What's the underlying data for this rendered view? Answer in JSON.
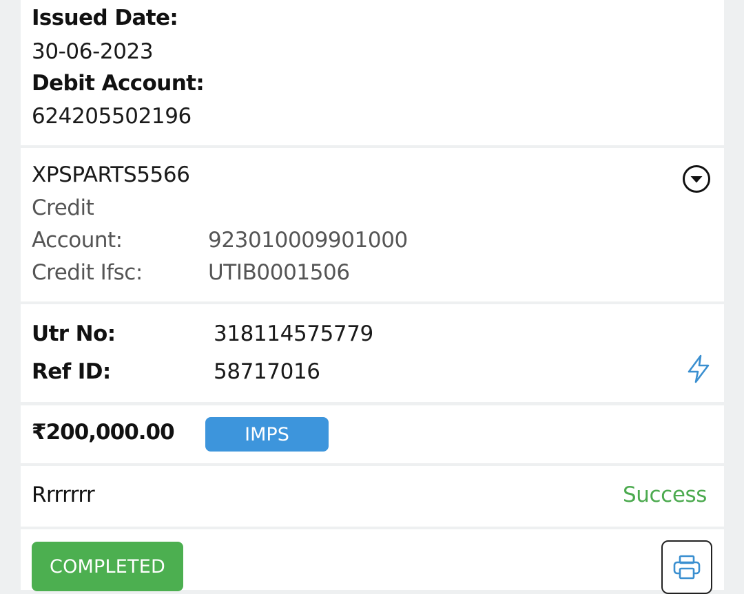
{
  "transaction": {
    "issued_date_label": "Issued Date:",
    "issued_date": "30-06-2023",
    "debit_account_label": "Debit Account:",
    "debit_account": "624205502196"
  },
  "beneficiary": {
    "name": "XPSPARTS5566",
    "credit_account_label_line1": "Credit",
    "credit_account_label_line2": "Account:",
    "credit_account": "923010009901000",
    "credit_ifsc_label": "Credit Ifsc:",
    "credit_ifsc": "UTIB0001506"
  },
  "references": {
    "utr_label": "Utr No:",
    "utr": "318114575779",
    "ref_id_label": "Ref ID:",
    "ref_id": "58717016"
  },
  "payment": {
    "amount": "₹200,000.00",
    "mode_badge": "IMPS"
  },
  "remark": {
    "text": "Rrrrrrr",
    "status": "Success"
  },
  "actions": {
    "completed_label": "COMPLETED"
  },
  "colors": {
    "accent_blue": "#3d95dc",
    "success_green": "#4caf50",
    "status_text_green": "#4caa4f",
    "icon_blue": "#3a8fd0"
  },
  "icons": {
    "expand": "chevron-down-circle-icon",
    "instant": "lightning-bolt-icon",
    "print": "printer-icon"
  }
}
